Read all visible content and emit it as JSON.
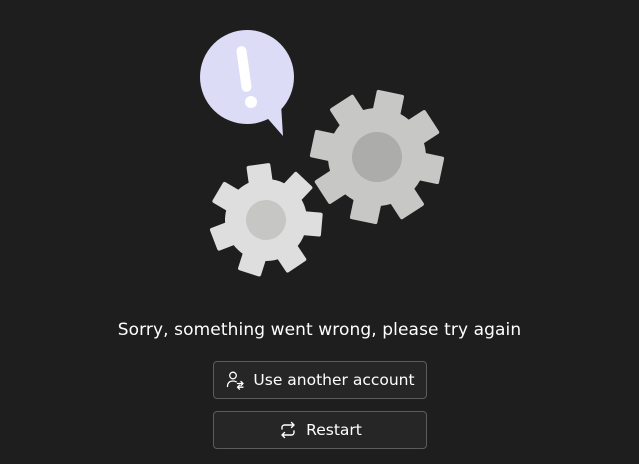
{
  "illustration": {
    "alert_glyph": "!",
    "bubble_color": "#dcdcf6",
    "gear_colors": [
      "#cbcbc9",
      "#dedede"
    ]
  },
  "error": {
    "message": "Sorry, something went wrong, please try again"
  },
  "actions": {
    "use_another_account": {
      "label": "Use another account",
      "icon": "person-switch-icon"
    },
    "restart": {
      "label": "Restart",
      "icon": "refresh-icon"
    }
  }
}
